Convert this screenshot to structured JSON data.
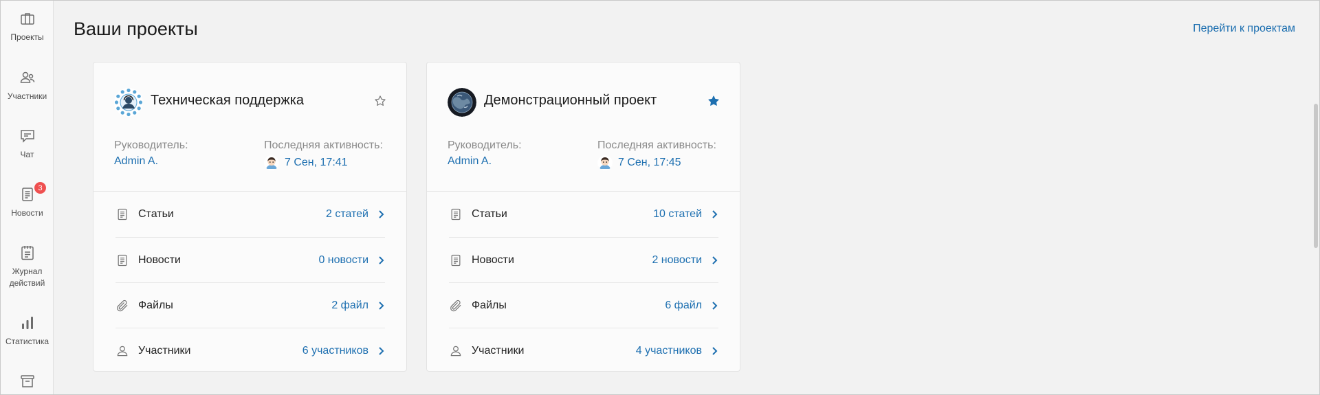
{
  "sidebar": {
    "items": [
      {
        "label": "Проекты",
        "icon": "briefcase-icon"
      },
      {
        "label": "Участники",
        "icon": "users-icon"
      },
      {
        "label": "Чат",
        "icon": "chat-icon"
      },
      {
        "label": "Новости",
        "icon": "news-icon",
        "badge": "3"
      },
      {
        "label": "Журнал действий",
        "icon": "journal-icon"
      },
      {
        "label": "Статистика",
        "icon": "stats-icon"
      },
      {
        "label": "",
        "icon": "archive-icon"
      }
    ]
  },
  "header": {
    "title": "Ваши проекты",
    "goto_link": "Перейти к проектам"
  },
  "projects": [
    {
      "title": "Техническая поддержка",
      "starred": false,
      "manager_label": "Руководитель:",
      "manager": "Admin A.",
      "activity_label": "Последняя активность:",
      "activity": "7 Сен, 17:41",
      "rows": [
        {
          "label": "Статьи",
          "count": "2 статей",
          "icon": "document-icon"
        },
        {
          "label": "Новости",
          "count": "0 новости",
          "icon": "document-icon"
        },
        {
          "label": "Файлы",
          "count": "2 файл",
          "icon": "paperclip-icon"
        },
        {
          "label": "Участники",
          "count": "6 участников",
          "icon": "user-icon"
        }
      ]
    },
    {
      "title": "Демонстрационный проект",
      "starred": true,
      "manager_label": "Руководитель:",
      "manager": "Admin A.",
      "activity_label": "Последняя активность:",
      "activity": "7 Сен, 17:45",
      "rows": [
        {
          "label": "Статьи",
          "count": "10 статей",
          "icon": "document-icon"
        },
        {
          "label": "Новости",
          "count": "2 новости",
          "icon": "document-icon"
        },
        {
          "label": "Файлы",
          "count": "6 файл",
          "icon": "paperclip-icon"
        },
        {
          "label": "Участники",
          "count": "4 участников",
          "icon": "user-icon"
        }
      ]
    }
  ],
  "colors": {
    "accent": "#1d6fb0",
    "badge": "#ef5050",
    "star_active": "#1d6fb0"
  }
}
